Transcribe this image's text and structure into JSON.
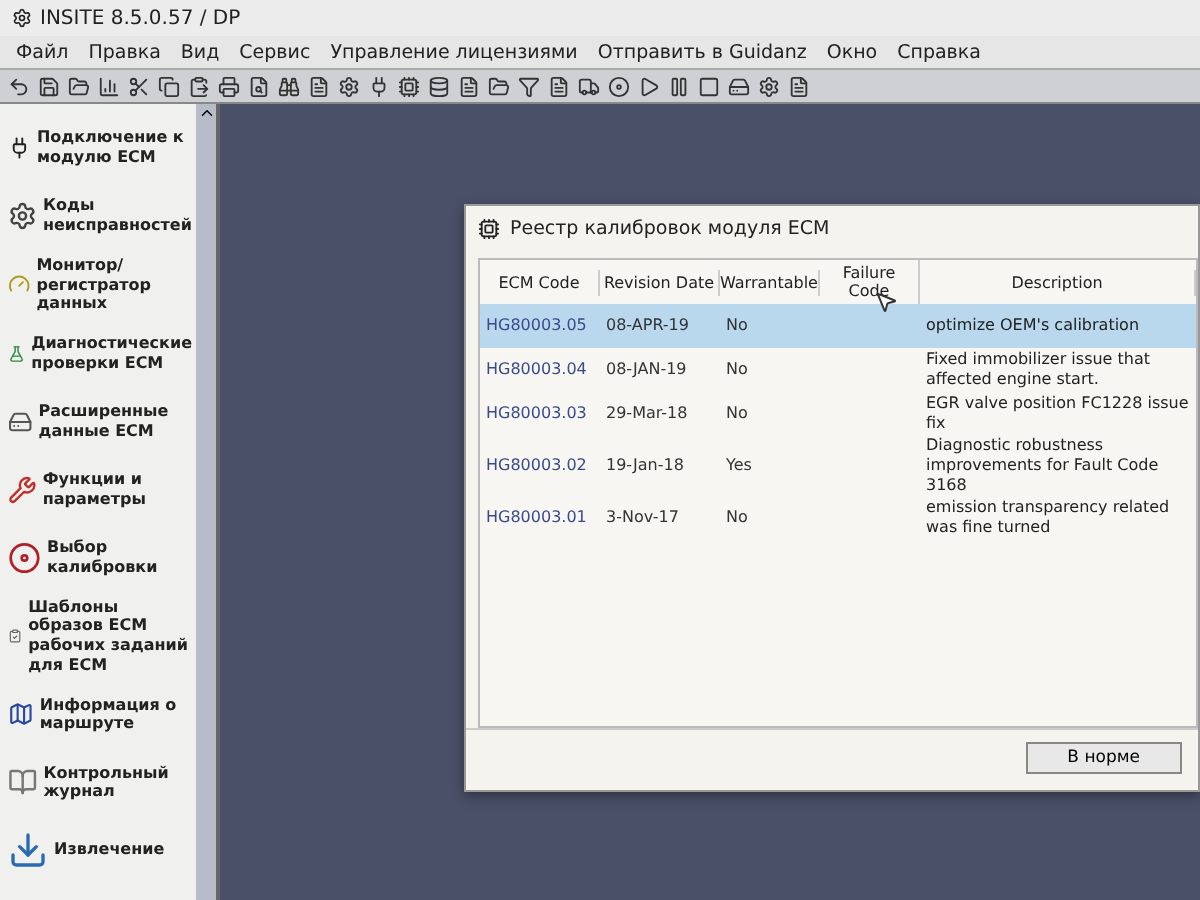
{
  "window": {
    "title": "INSITE 8.5.0.57 / DP"
  },
  "menu": [
    "Файл",
    "Правка",
    "Вид",
    "Сервис",
    "Управление лицензиями",
    "Отправить в Guidanz",
    "Окно",
    "Справка"
  ],
  "sidebar": {
    "items": [
      {
        "label": "Подключение к модулю ECM"
      },
      {
        "label": "Коды неисправностей"
      },
      {
        "label": "Монитор/регистратор данных"
      },
      {
        "label": "Диагностические проверки ECM"
      },
      {
        "label": "Расширенные данные ECM"
      },
      {
        "label": "Функции и параметры"
      },
      {
        "label": "Выбор калибровки"
      },
      {
        "label": "Шаблоны образов ECM рабочих заданий для ECM"
      },
      {
        "label": "Информация о маршруте"
      },
      {
        "label": "Контрольный журнал"
      },
      {
        "label": "Извлечение"
      }
    ]
  },
  "dialog": {
    "title": "Реестр калибровок модуля ECM",
    "table": {
      "columns": [
        "ECM Code",
        "Revision Date",
        "Warrantable",
        "Failure Code",
        "Description"
      ],
      "rows": [
        {
          "cells": [
            "HG80003.05",
            "08-APR-19",
            "No",
            "",
            "optimize  OEM's calibration"
          ],
          "selected": true
        },
        {
          "cells": [
            "HG80003.04",
            "08-JAN-19",
            "No",
            "",
            "Fixed immobilizer issue that affected engine start."
          ],
          "selected": false
        },
        {
          "cells": [
            "HG80003.03",
            "29-Mar-18",
            "No",
            "",
            "EGR valve position FC1228 issue fix"
          ],
          "selected": false
        },
        {
          "cells": [
            "HG80003.02",
            "19-Jan-18",
            "Yes",
            "",
            "Diagnostic robustness improvements for Fault Code 3168"
          ],
          "selected": false
        },
        {
          "cells": [
            "HG80003.01",
            "3-Nov-17",
            "No",
            "",
            "emission transparency related was fine turned"
          ],
          "selected": false
        }
      ]
    },
    "button": "В норме"
  }
}
